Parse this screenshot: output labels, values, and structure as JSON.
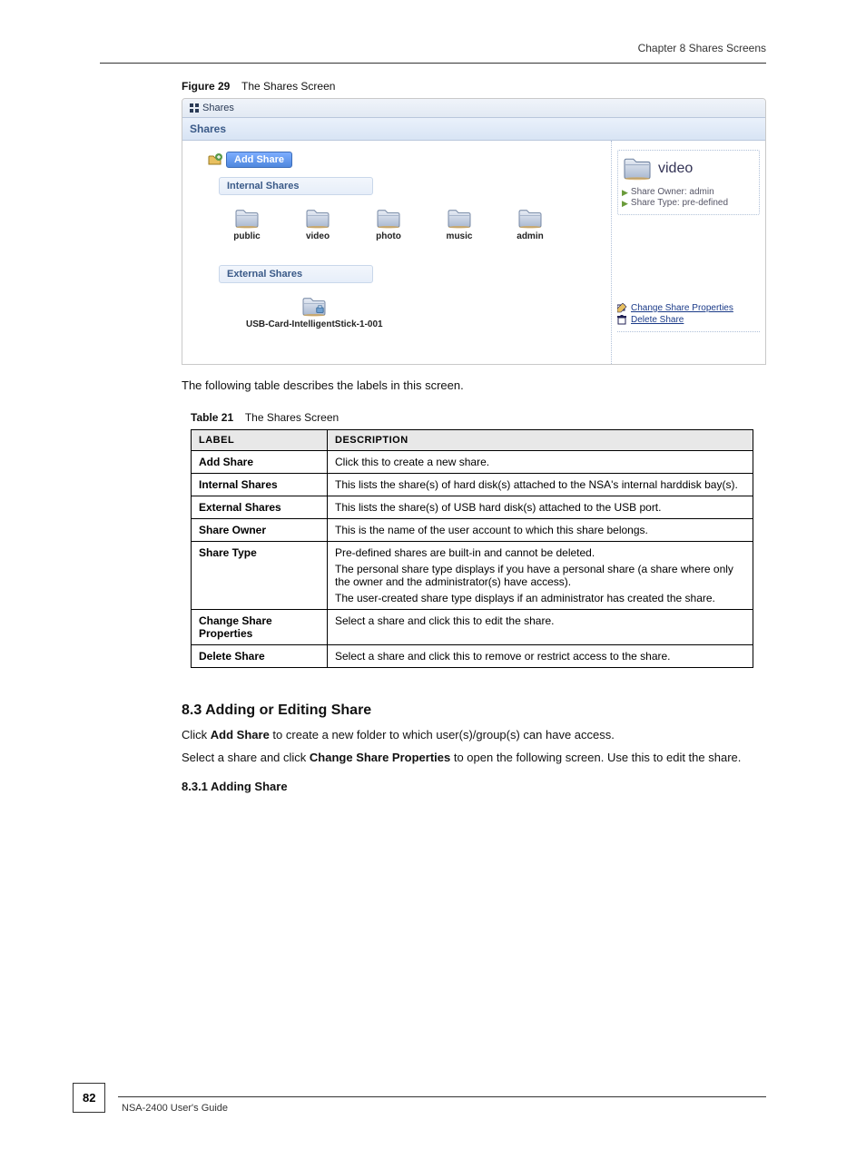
{
  "header": {
    "right": "",
    "chapter": "Chapter 8 Shares Screens"
  },
  "figure": {
    "label": "Figure 29",
    "caption": "The Shares Screen"
  },
  "screenshot": {
    "titlebar": "Shares",
    "sharesbar": "Shares",
    "add_share_label": "Add Share",
    "internal_hdr": "Internal Shares",
    "internal": [
      {
        "name": "public"
      },
      {
        "name": "video"
      },
      {
        "name": "photo"
      },
      {
        "name": "music"
      },
      {
        "name": "admin"
      }
    ],
    "external_hdr": "External Shares",
    "external": [
      {
        "name": "USB-Card-IntelligentStick-1-001"
      }
    ],
    "side": {
      "title": "video",
      "owner_label": "Share Owner:",
      "owner_value": "admin",
      "type_label": "Share Type:",
      "type_value": "pre-defined",
      "action_change": "Change Share Properties",
      "action_delete": "Delete Share"
    }
  },
  "body_text": "The following table describes the labels in this screen.",
  "table_caption_label": "Table 21",
  "table_caption_text": "The Shares Screen",
  "table": {
    "headers": [
      "LABEL",
      "DESCRIPTION"
    ],
    "rows": [
      {
        "k": "Add Share",
        "v": "Click this to create a new share."
      },
      {
        "k": "Internal Shares",
        "v": "This lists the share(s) of hard disk(s) attached to the NSA's internal harddisk bay(s)."
      },
      {
        "k": "External Shares",
        "v": "This lists the share(s) of USB hard disk(s) attached to the USB port."
      },
      {
        "k": "Share Owner",
        "v": "This is the name of the user account to which this share belongs."
      },
      {
        "k": "Share Type",
        "v": "Pre-defined shares are built-in and cannot be deleted.\nThe personal share type displays if you have a personal share (a share where only the owner and the administrator(s) have access).\nThe user-created share type displays if an administrator has created the share."
      },
      {
        "k": "Change Share Properties",
        "v": "Select a share and click this to edit the share."
      },
      {
        "k": "Delete Share",
        "v": "Select a share and click this to remove or restrict access to the share."
      }
    ]
  },
  "section": {
    "heading": "8.3  Adding or Editing Share",
    "p1_a": "Click ",
    "p1_b": "Add Share",
    "p1_c": " to create a new folder to which user(s)/group(s) can have access.",
    "p2_a": "Select a share and click ",
    "p2_b": "Change Share Properties",
    "p2_c": " to open the following screen. Use this to edit the share.",
    "subhead": "8.3.1  Adding Share"
  },
  "footer": {
    "page": "82",
    "text": "NSA-2400 User's Guide"
  }
}
